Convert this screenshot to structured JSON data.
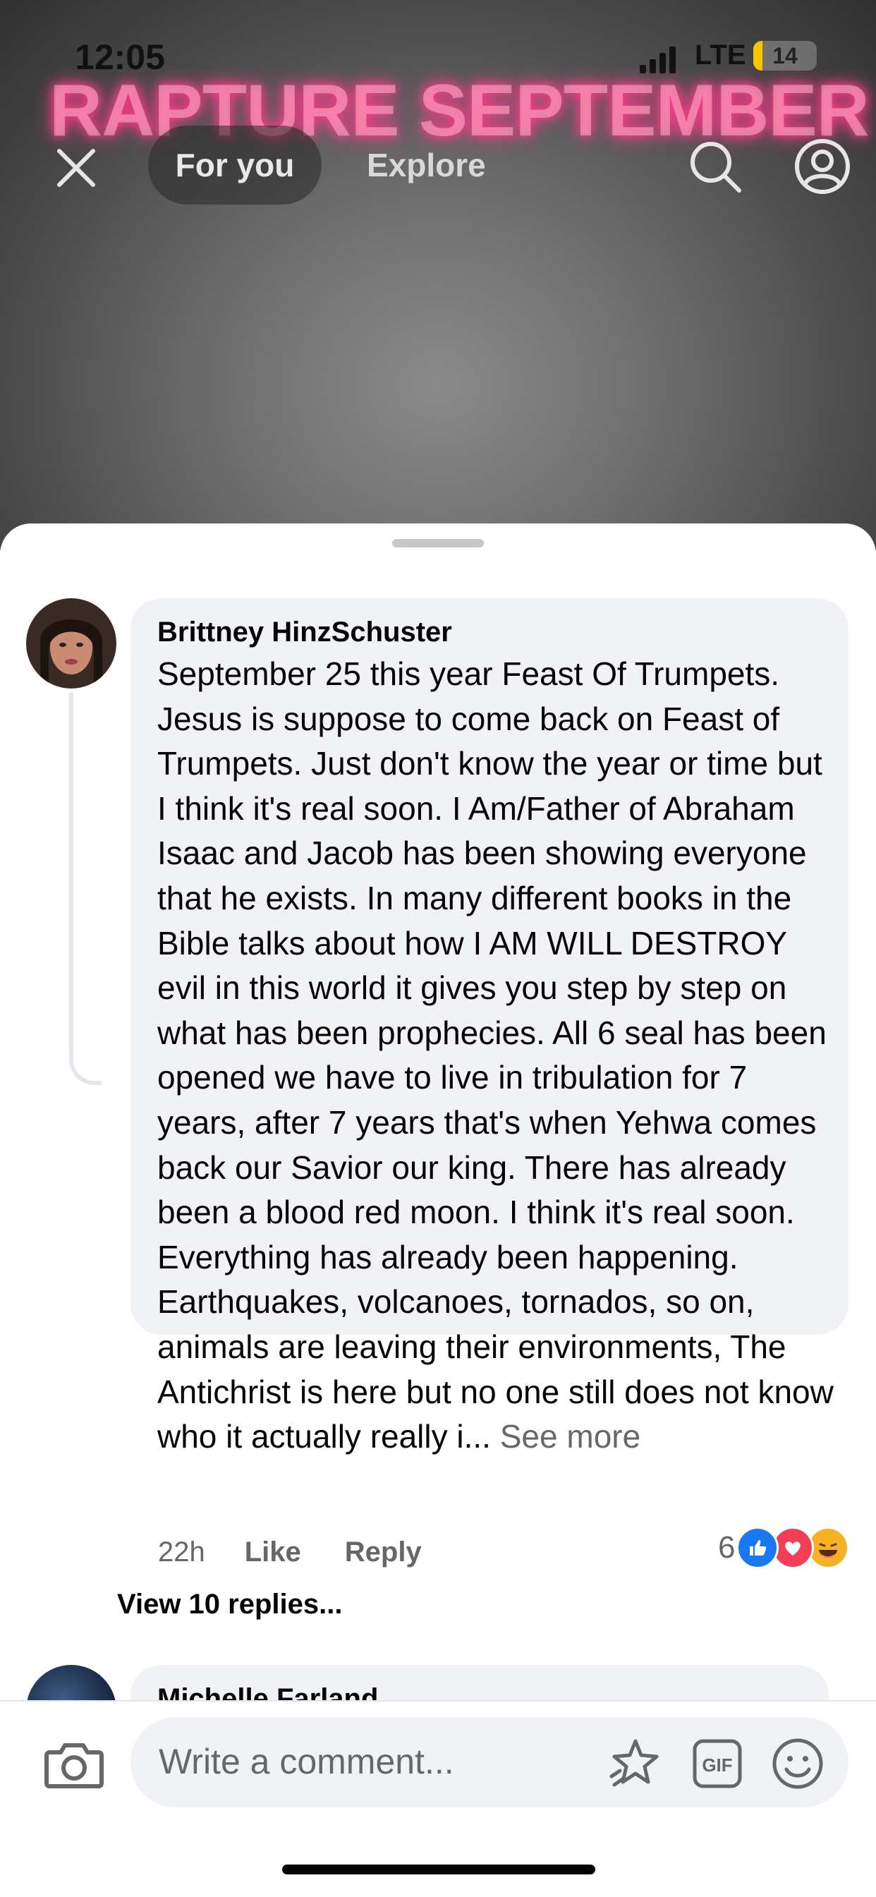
{
  "status_bar": {
    "time": "12:05",
    "network": "LTE",
    "battery": "14",
    "battery_level": 0.14
  },
  "video": {
    "overlay_title": "RAPTURE SEPTEMBER"
  },
  "nav": {
    "close_icon": "close-icon",
    "for_you": "For you",
    "explore": "Explore",
    "search_icon": "search-icon",
    "profile_icon": "profile-icon"
  },
  "comment": {
    "author": "Brittney HinzSchuster",
    "text": "September 25 this year Feast Of Trumpets. Jesus is suppose to come back on Feast of Trumpets. Just don't know the year or time but I think it's real soon. I Am/Father of Abraham Isaac and Jacob has been showing everyone that he exists. In many different books in the Bible talks about how I AM WILL DESTROY evil in this world it gives you step by step on what has been prophecies. All 6 seal has been opened we have to live in tribulation for 7 years, after 7 years that's when Yehwa comes back our Savior our king. There has already been a blood red moon. I think it's real soon. Everything has already been happening. Earthquakes, volcanoes, tornados, so on, animals are leaving their environments, The Antichrist is here but no one still does not know who it actually really i...",
    "see_more": " See more",
    "time_ago": "22h",
    "like": "Like",
    "reply": "Reply",
    "reaction_count": "6",
    "reactions": [
      "like",
      "love",
      "haha"
    ],
    "view_replies": "View 10 replies..."
  },
  "next_comment": {
    "author": "Michelle Farland"
  },
  "composer": {
    "placeholder": "Write a comment...",
    "camera_icon": "camera-icon",
    "sticker_icon": "sticker-icon",
    "gif_label": "GIF",
    "emoji_icon": "emoji-icon"
  },
  "colors": {
    "accent_blue": "#1877f2",
    "love_red": "#f33e58",
    "haha_yellow": "#f7b125",
    "neon_pink": "#ff3d8b"
  }
}
